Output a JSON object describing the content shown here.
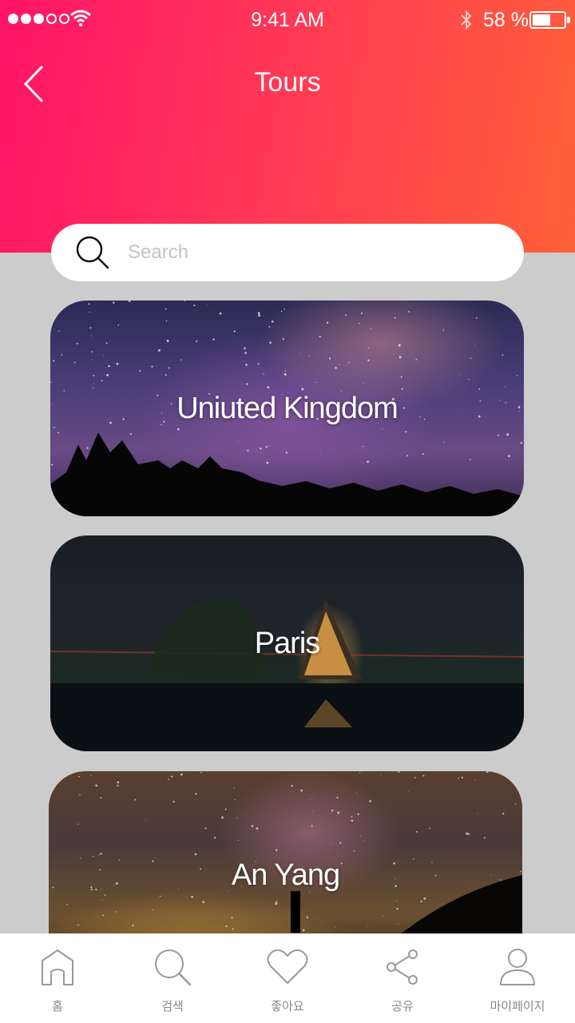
{
  "status_bar": {
    "time": "9:41 AM",
    "battery_text": "58 %",
    "battery_level": 0.58
  },
  "header": {
    "title": "Tours",
    "back_icon": "chevron-left-icon",
    "gradient": [
      "#ff1468",
      "#ff6038"
    ]
  },
  "search": {
    "placeholder": "Search",
    "value": "",
    "icon": "search-icon"
  },
  "tours": [
    {
      "name": "Uniuted Kingdom"
    },
    {
      "name": "Paris"
    },
    {
      "name": "An Yang"
    }
  ],
  "tab_bar": {
    "items": [
      {
        "label": "홈",
        "icon": "home-icon"
      },
      {
        "label": "검색",
        "icon": "search-icon"
      },
      {
        "label": "좋아요",
        "icon": "heart-icon"
      },
      {
        "label": "공유",
        "icon": "share-icon"
      },
      {
        "label": "마이페이지",
        "icon": "user-icon"
      }
    ]
  }
}
